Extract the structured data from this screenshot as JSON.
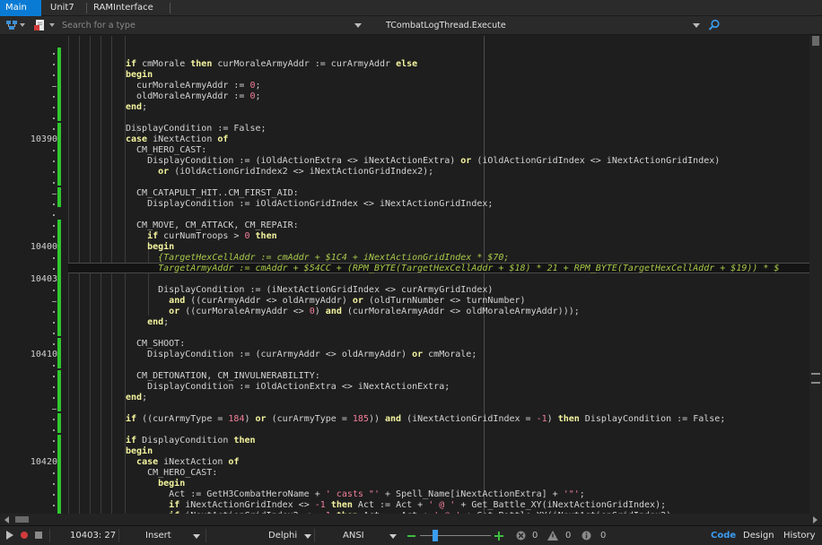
{
  "tabs": [
    {
      "label": "Main",
      "active": true
    },
    {
      "label": "Unit7",
      "active": false
    },
    {
      "label": "RAMInterface",
      "active": false
    }
  ],
  "toolbar": {
    "search_placeholder": "Search for a type",
    "method": "TCombatLogThread.Execute"
  },
  "editor": {
    "current_line": "10403",
    "line_numbers": [
      {
        "n": "10390",
        "row": 8
      },
      {
        "n": "10400",
        "row": 18
      },
      {
        "n": "10403",
        "row": 21
      },
      {
        "n": "10410",
        "row": 28
      },
      {
        "n": "10420",
        "row": 38
      }
    ],
    "lines": [
      [],
      [
        {
          "t": "if",
          "c": "kw"
        },
        {
          "t": " cmMorale "
        },
        {
          "t": "then",
          "c": "kw"
        },
        {
          "t": " curMoraleArmyAddr := curArmyAddr "
        },
        {
          "t": "else",
          "c": "kw"
        }
      ],
      [
        {
          "t": "begin",
          "c": "kw"
        }
      ],
      [
        {
          "t": "  curMoraleArmyAddr := "
        },
        {
          "t": "0",
          "c": "num"
        },
        {
          "t": ";"
        }
      ],
      [
        {
          "t": "  oldMoraleArmyAddr := "
        },
        {
          "t": "0",
          "c": "num"
        },
        {
          "t": ";"
        }
      ],
      [
        {
          "t": "end",
          "c": "kw"
        },
        {
          "t": ";"
        }
      ],
      [],
      [
        {
          "t": "DisplayCondition := False;"
        }
      ],
      [
        {
          "t": "case",
          "c": "kw"
        },
        {
          "t": " iNextAction "
        },
        {
          "t": "of",
          "c": "kw"
        }
      ],
      [
        {
          "t": "  CM_HERO_CAST:"
        }
      ],
      [
        {
          "t": "    DisplayCondition := (iOldActionExtra <> iNextActionExtra) "
        },
        {
          "t": "or",
          "c": "kw"
        },
        {
          "t": " (iOldActionGridIndex <> iNextActionGridIndex)"
        }
      ],
      [
        {
          "t": "      "
        },
        {
          "t": "or",
          "c": "kw"
        },
        {
          "t": " (iOldActionGridIndex2 <> iNextActionGridIndex2);"
        }
      ],
      [],
      [
        {
          "t": "  CM_CATAPULT_HIT..CM_FIRST_AID:"
        }
      ],
      [
        {
          "t": "    DisplayCondition := iOldActionGridIndex <> iNextActionGridIndex;"
        }
      ],
      [],
      [
        {
          "t": "  CM_MOVE, CM_ATTACK, CM_REPAIR:"
        }
      ],
      [
        {
          "t": "    "
        },
        {
          "t": "if",
          "c": "kw"
        },
        {
          "t": " curNumTroops > "
        },
        {
          "t": "0",
          "c": "num"
        },
        {
          "t": " "
        },
        {
          "t": "then",
          "c": "kw"
        }
      ],
      [
        {
          "t": "    "
        },
        {
          "t": "begin",
          "c": "kw"
        }
      ],
      [
        {
          "t": "      {TargetHexCellAddr := cmAddr + $1C4 + iNextActionGridIndex * $70;",
          "c": "cmt"
        }
      ],
      [
        {
          "t": "      TargetArmyAddr := cmAddr + $54CC + (RPM_BYTE(TargetHexCellAddr + $18) * 21 + RPM_BYTE(TargetHexCellAddr + $19)) * $",
          "c": "cmt"
        }
      ],
      [],
      [
        {
          "t": "      DisplayCondition := (iNextActionGridIndex <> curArmyGridIndex)"
        }
      ],
      [
        {
          "t": "        "
        },
        {
          "t": "and",
          "c": "kw"
        },
        {
          "t": " ((curArmyAddr <> oldArmyAddr) "
        },
        {
          "t": "or",
          "c": "kw"
        },
        {
          "t": " (oldTurnNumber <> turnNumber)"
        }
      ],
      [
        {
          "t": "        "
        },
        {
          "t": "or",
          "c": "kw"
        },
        {
          "t": " ((curMoraleArmyAddr <> "
        },
        {
          "t": "0",
          "c": "num"
        },
        {
          "t": ") "
        },
        {
          "t": "and",
          "c": "kw"
        },
        {
          "t": " (curMoraleArmyAddr <> oldMoraleArmyAddr)));"
        }
      ],
      [
        {
          "t": "    "
        },
        {
          "t": "end",
          "c": "kw"
        },
        {
          "t": ";"
        }
      ],
      [],
      [
        {
          "t": "  CM_SHOOT:"
        }
      ],
      [
        {
          "t": "    DisplayCondition := (curArmyAddr <> oldArmyAddr) "
        },
        {
          "t": "or",
          "c": "kw"
        },
        {
          "t": " cmMorale;"
        }
      ],
      [],
      [
        {
          "t": "  CM_DETONATION, CM_INVULNERABILITY:"
        }
      ],
      [
        {
          "t": "    DisplayCondition := iOldActionExtra <> iNextActionExtra;"
        }
      ],
      [
        {
          "t": "end",
          "c": "kw"
        },
        {
          "t": ";"
        }
      ],
      [],
      [
        {
          "t": "if",
          "c": "kw"
        },
        {
          "t": " ((curArmyType = "
        },
        {
          "t": "184",
          "c": "num"
        },
        {
          "t": ") "
        },
        {
          "t": "or",
          "c": "kw"
        },
        {
          "t": " (curArmyType = "
        },
        {
          "t": "185",
          "c": "num"
        },
        {
          "t": ")) "
        },
        {
          "t": "and",
          "c": "kw"
        },
        {
          "t": " (iNextActionGridIndex = "
        },
        {
          "t": "-1",
          "c": "num"
        },
        {
          "t": ") "
        },
        {
          "t": "then",
          "c": "kw"
        },
        {
          "t": " DisplayCondition := False;"
        }
      ],
      [],
      [
        {
          "t": "if",
          "c": "kw"
        },
        {
          "t": " DisplayCondition "
        },
        {
          "t": "then",
          "c": "kw"
        }
      ],
      [
        {
          "t": "begin",
          "c": "kw"
        }
      ],
      [
        {
          "t": "  "
        },
        {
          "t": "case",
          "c": "kw"
        },
        {
          "t": " iNextAction "
        },
        {
          "t": "of",
          "c": "kw"
        }
      ],
      [
        {
          "t": "    CM_HERO_CAST:"
        }
      ],
      [
        {
          "t": "      "
        },
        {
          "t": "begin",
          "c": "kw"
        }
      ],
      [
        {
          "t": "        Act := GetH3CombatHeroName + "
        },
        {
          "t": "' casts \"'",
          "c": "str"
        },
        {
          "t": " + Spell_Name[iNextActionExtra] + "
        },
        {
          "t": "'\"'",
          "c": "str"
        },
        {
          "t": ";"
        }
      ],
      [
        {
          "t": "        "
        },
        {
          "t": "if",
          "c": "kw"
        },
        {
          "t": " iNextActionGridIndex <> "
        },
        {
          "t": "-1",
          "c": "num"
        },
        {
          "t": " "
        },
        {
          "t": "then",
          "c": "kw"
        },
        {
          "t": " Act := Act + "
        },
        {
          "t": "' @ '",
          "c": "str"
        },
        {
          "t": " + Get_Battle_XY(iNextActionGridIndex);"
        }
      ],
      [
        {
          "t": "        "
        },
        {
          "t": "if",
          "c": "kw"
        },
        {
          "t": " iNextActionGridIndex2 <> "
        },
        {
          "t": "-1",
          "c": "num"
        },
        {
          "t": " "
        },
        {
          "t": "then",
          "c": "kw"
        },
        {
          "t": " Act := Act + "
        },
        {
          "t": "' @ '",
          "c": "str"
        },
        {
          "t": " + Get_Battle_XY(iNextActionGridIndex2);"
        }
      ]
    ]
  },
  "status": {
    "position": "10403: 27",
    "mode": "Insert",
    "language": "Delphi",
    "encoding": "ANSI",
    "errors": "0",
    "warnings": "0",
    "hints": "0",
    "views": [
      {
        "label": "Code",
        "active": true
      },
      {
        "label": "Design",
        "active": false
      },
      {
        "label": "History",
        "active": false
      }
    ]
  },
  "colors": {
    "accent": "#0a7bd4",
    "keyword": "#f4f4a0",
    "number": "#f27f9a",
    "comment": "#a8c84a",
    "modified_bar": "#2fc62f"
  }
}
